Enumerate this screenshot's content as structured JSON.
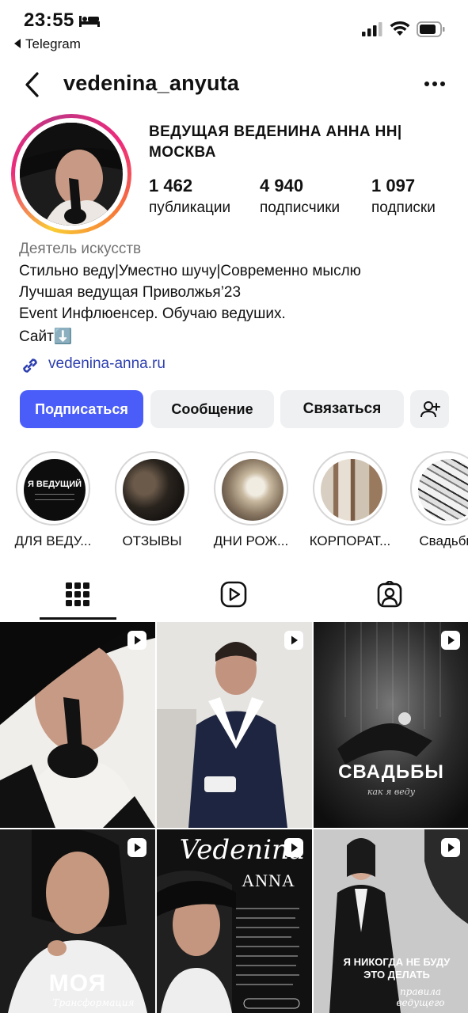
{
  "status_bar": {
    "time": "23:55",
    "back_app": "Telegram"
  },
  "header": {
    "username": "vedenina_anyuta"
  },
  "profile": {
    "display_name": "ВЕДУЩАЯ ВЕДЕНИНА АННА НН| МОСКВА",
    "stats": [
      {
        "value": "1 462",
        "label": "публикации"
      },
      {
        "value": "4 940",
        "label": "подписчики"
      },
      {
        "value": "1 097",
        "label": "подписки"
      }
    ],
    "category": "Деятель искусств",
    "bio": [
      "Стильно веду|Уместно шучу|Современно мыслю",
      "Лучшая ведущая Приволжья’23",
      "Event Инфлюенсер. Обучаю ведуших.",
      "Сайт⬇️"
    ],
    "link": "vedenina-anna.ru"
  },
  "actions": {
    "follow": "Подписаться",
    "message": "Сообщение",
    "contact": "Связаться"
  },
  "highlights": [
    {
      "label": "ДЛЯ ВЕДУ...",
      "cover_text": "Я ВЕДУЩИЙ"
    },
    {
      "label": "ОТЗЫВЫ"
    },
    {
      "label": "ДНИ РОЖ..."
    },
    {
      "label": "КОРПОРАТ..."
    },
    {
      "label": "Свадьбы"
    }
  ],
  "tabs": [
    {
      "icon": "grid-icon",
      "active": true
    },
    {
      "icon": "reels-icon",
      "active": false
    },
    {
      "icon": "tagged-icon",
      "active": false
    }
  ],
  "posts": [
    {
      "type": "reel"
    },
    {
      "type": "reel"
    },
    {
      "type": "reel",
      "title": "СВАДЬБЫ",
      "subtitle": "как я веду"
    },
    {
      "type": "reel",
      "title": "МОЯ",
      "subtitle": "Трансформация"
    },
    {
      "type": "reel",
      "title": "Vedenina",
      "subtitle": "ANNA"
    },
    {
      "type": "reel",
      "title": "Я НИКОГДА НЕ БУДУ ЭТО ДЕЛАТЬ",
      "subtitle": "правила ведущего"
    }
  ],
  "colors": {
    "accent": "#4a5df9",
    "link": "#2d3fb0",
    "secondary_button": "#eff0f2",
    "muted_text": "#737373"
  }
}
